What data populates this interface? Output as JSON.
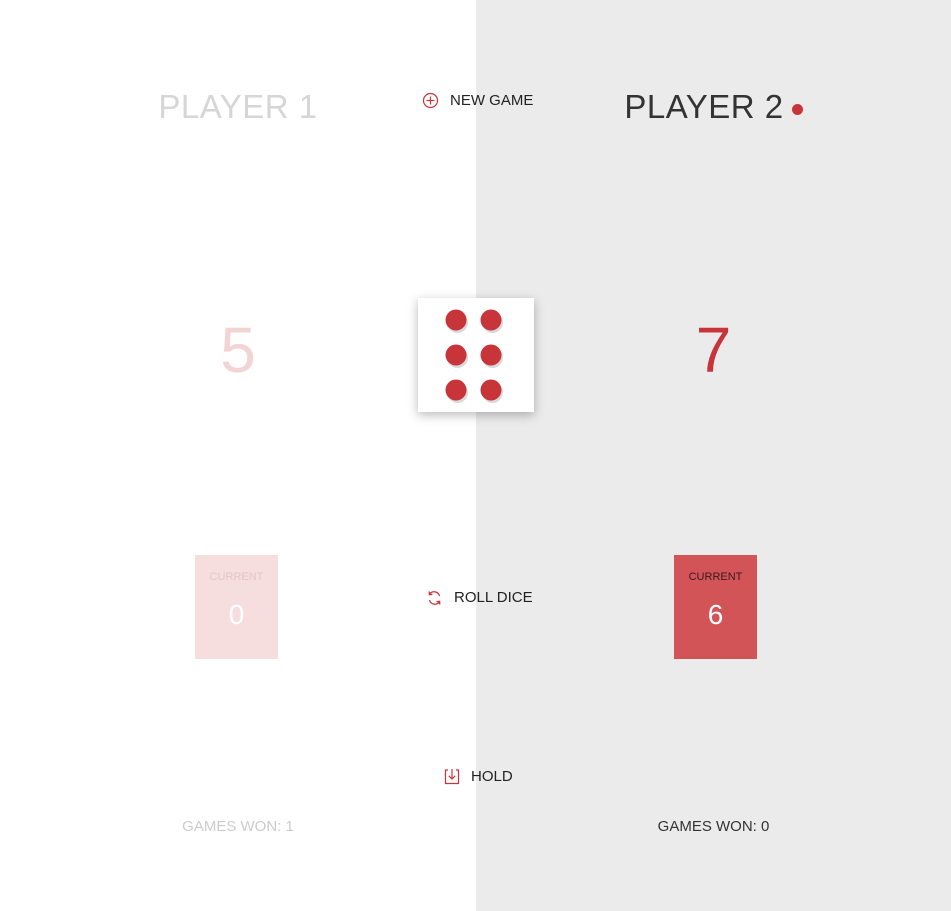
{
  "controls": {
    "new_game_label": "New game",
    "roll_dice_label": "Roll dice",
    "hold_label": "Hold"
  },
  "players": [
    {
      "name": "Player 1",
      "score": "5",
      "current_label": "Current",
      "current_score": "0",
      "games_won_label": "Games won: 1",
      "active": false
    },
    {
      "name": "Player 2",
      "score": "7",
      "current_label": "Current",
      "current_score": "6",
      "games_won_label": "Games won: 0",
      "active": true
    }
  ],
  "dice": {
    "value": 6,
    "pip_color": "#c7353a"
  },
  "colors": {
    "accent": "#c7353a",
    "active_panel": "#ebebeb",
    "inactive_panel": "#ffffff",
    "active_current_bg": "#d35457",
    "inactive_current_bg": "#f6dede"
  },
  "icons": {
    "new_game": "plus-circle-icon",
    "roll_dice": "refresh-icon",
    "hold": "download-icon"
  }
}
